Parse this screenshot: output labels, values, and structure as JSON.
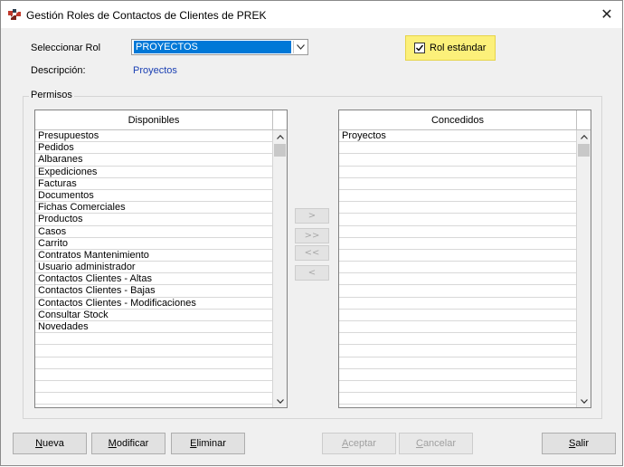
{
  "window": {
    "title": "Gestión Roles de Contactos de Clientes de PREK"
  },
  "form": {
    "role_label": "Seleccionar Rol",
    "role_value": "PROYECTOS",
    "description_label": "Descripción:",
    "description_value": "Proyectos",
    "standard_role_label": "Rol estándar",
    "standard_role_checked": true
  },
  "permissions": {
    "group_title": "Permisos",
    "available": {
      "header": "Disponibles",
      "items": [
        "Presupuestos",
        "Pedidos",
        "Albaranes",
        "Expediciones",
        "Facturas",
        "Documentos",
        "Fichas Comerciales",
        "Productos",
        "Casos",
        "Carrito",
        "Contratos Mantenimiento",
        "Usuario administrador",
        "Contactos Clientes - Altas",
        "Contactos Clientes - Bajas",
        "Contactos Clientes - Modificaciones",
        "Consultar Stock",
        "Novedades"
      ]
    },
    "granted": {
      "header": "Concedidos",
      "items": [
        "Proyectos"
      ]
    },
    "transfer_buttons": [
      ">",
      ">>",
      "<<",
      "<"
    ]
  },
  "buttons": {
    "nueva": {
      "prefix": "",
      "key": "N",
      "rest": "ueva"
    },
    "modificar": {
      "prefix": "",
      "key": "M",
      "rest": "odificar"
    },
    "eliminar": {
      "prefix": "",
      "key": "E",
      "rest": "liminar"
    },
    "aceptar": {
      "prefix": "",
      "key": "A",
      "rest": "ceptar"
    },
    "cancelar": {
      "prefix": "",
      "key": "C",
      "rest": "ancelar"
    },
    "salir": {
      "prefix": "",
      "key": "S",
      "rest": "alir"
    }
  },
  "colors": {
    "highlight": "#0078d7",
    "checkbox_panel": "#fcf07a",
    "description_text": "#1a3fb3"
  }
}
